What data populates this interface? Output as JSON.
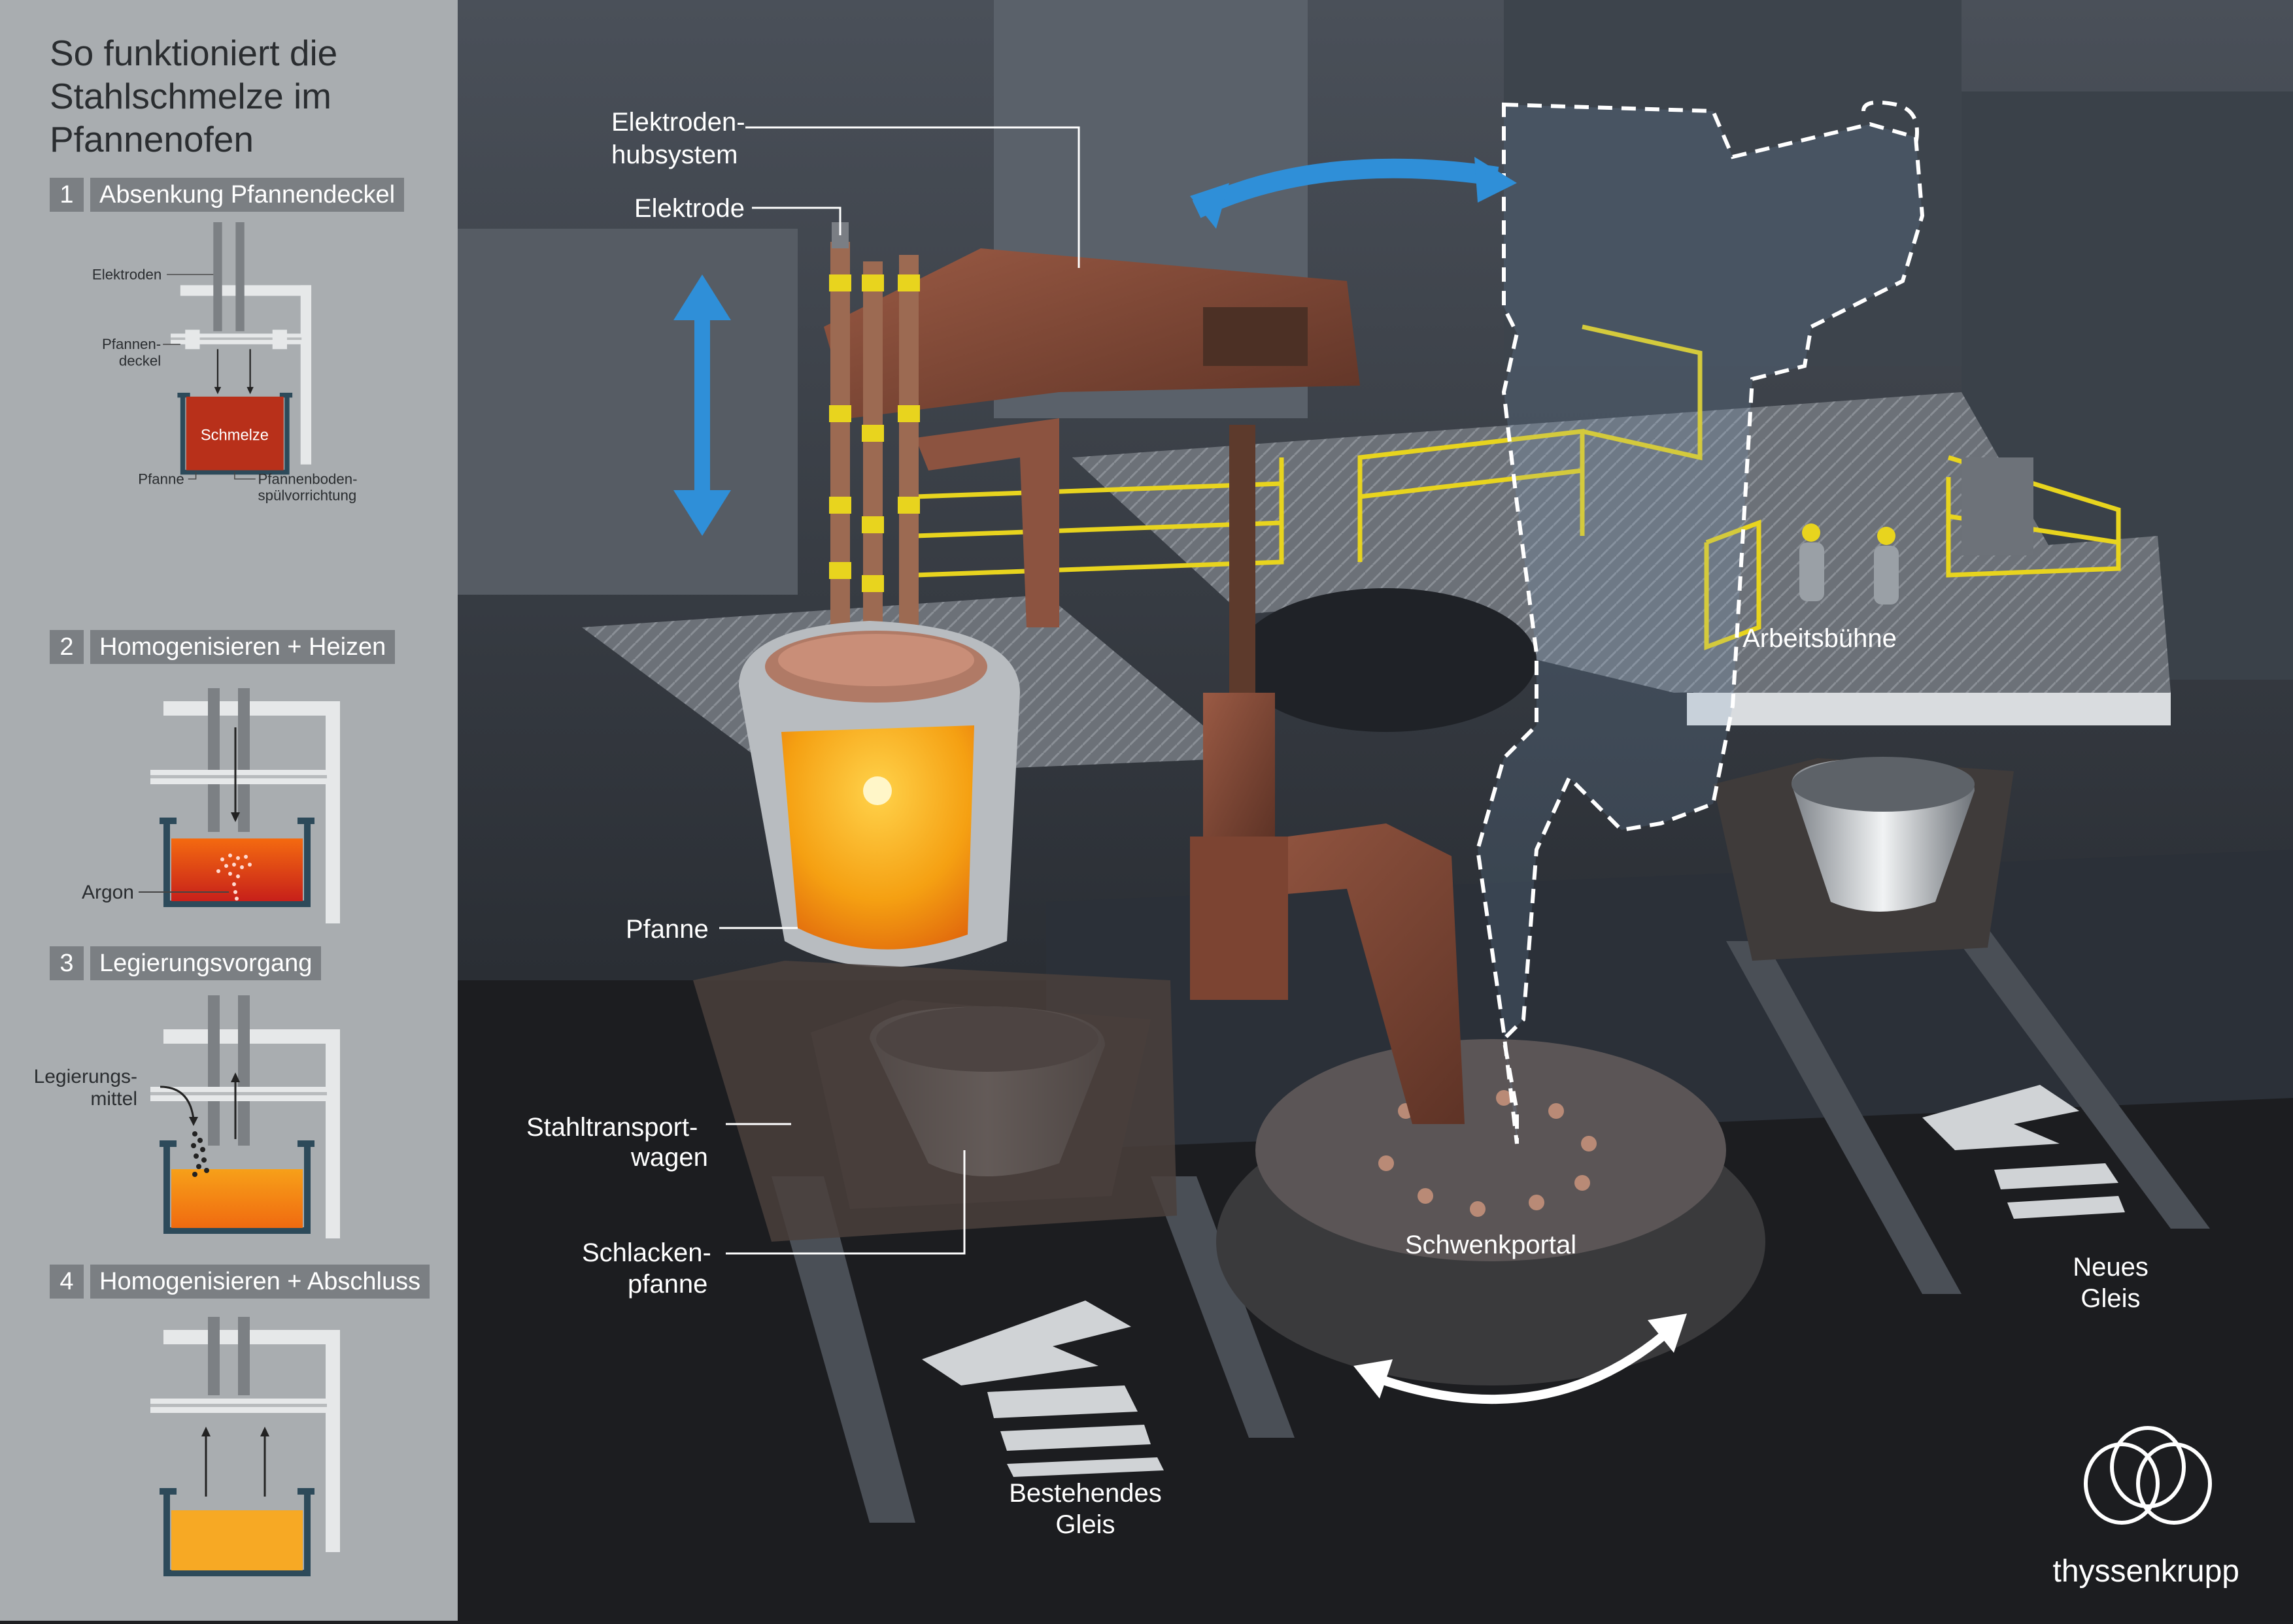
{
  "sidebar": {
    "title_lines": [
      "So funktioniert die",
      "Stahlschmelze im",
      "Pfannenofen"
    ],
    "steps": [
      {
        "num": "1",
        "title": "Absenkung Pfannendeckel"
      },
      {
        "num": "2",
        "title": "Homogenisieren + Heizen"
      },
      {
        "num": "3",
        "title": "Legierungsvorgang"
      },
      {
        "num": "4",
        "title": "Homogenisieren + Abschluss"
      }
    ],
    "step1_labels": {
      "electrodes": "Elektroden",
      "lid_1": "Pfannen-",
      "lid_2": "deckel",
      "melt": "Schmelze",
      "ladle": "Pfanne",
      "purge_1": "Pfannenboden-",
      "purge_2": "spülvorrichtung"
    },
    "step2_labels": {
      "argon": "Argon"
    },
    "step3_labels": {
      "alloy_1": "Legierungs-",
      "alloy_2": "mittel"
    }
  },
  "callouts": {
    "hub_1": "Elektroden-",
    "hub_2": "hubsystem",
    "electrode": "Elektrode",
    "ladle": "Pfanne",
    "wagon_1": "Stahltransport-",
    "wagon_2": "wagen",
    "slag_1": "Schlacken-",
    "slag_2": "pfanne",
    "platform": "Arbeitsbühne",
    "portal": "Schwenkportal",
    "track_existing_1": "Bestehendes",
    "track_existing_2": "Gleis",
    "track_new_1": "Neues",
    "track_new_2": "Gleis"
  },
  "logo": {
    "wordmark": "thyssenkrupp"
  },
  "colors": {
    "sidebar_bg": "#a9adb0",
    "step_badge": "#7b7f83",
    "scene_bg": "#1e1f22",
    "arrow_blue": "#2f8fd8",
    "railing_yellow": "#e8d41e",
    "melt_orange": "#f59a10",
    "melt_red": "#c2381a",
    "rust": "#8a4a34"
  }
}
